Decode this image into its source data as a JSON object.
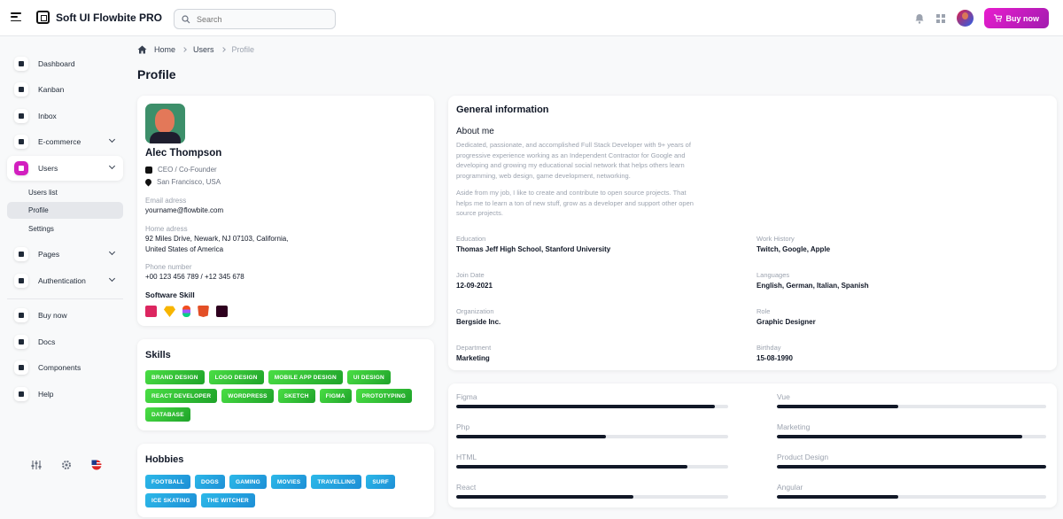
{
  "app": {
    "title": "Soft UI Flowbite PRO"
  },
  "search": {
    "placeholder": "Search"
  },
  "header": {
    "buy_label": "Buy now"
  },
  "sidebar": {
    "items": [
      {
        "label": "Dashboard",
        "icon": "dashboard-icon"
      },
      {
        "label": "Kanban",
        "icon": "kanban-icon"
      },
      {
        "label": "Inbox",
        "icon": "inbox-icon"
      },
      {
        "label": "E-commerce",
        "icon": "ecommerce-icon"
      },
      {
        "label": "Users",
        "icon": "users-icon"
      },
      {
        "label": "Pages",
        "icon": "pages-icon"
      },
      {
        "label": "Authentication",
        "icon": "authentication-icon"
      },
      {
        "label": "Buy now",
        "icon": "cart-icon"
      },
      {
        "label": "Docs",
        "icon": "docs-icon"
      },
      {
        "label": "Components",
        "icon": "components-icon"
      },
      {
        "label": "Help",
        "icon": "help-icon"
      }
    ],
    "users_sub": [
      "Users list",
      "Profile",
      "Settings"
    ]
  },
  "breadcrumb": {
    "home": "Home",
    "users": "Users",
    "current": "Profile"
  },
  "page": {
    "title": "Profile"
  },
  "profile": {
    "name": "Alec Thompson",
    "role": "CEO / Co-Founder",
    "location": "San Francisco, USA",
    "email_label": "Email adress",
    "email": "yourname@flowbite.com",
    "home_label": "Home adress",
    "home_line1": "92 Miles Drive, Newark, NJ 07103, California,",
    "home_line2": "United States of America",
    "phone_label": "Phone number",
    "phone": "+00 123 456 789 / +12 345 678",
    "software_title": "Software Skill"
  },
  "skills": {
    "title": "Skills",
    "tags": [
      "BRAND DESIGN",
      "LOGO DESIGN",
      "MOBILE APP DESIGN",
      "UI DESIGN",
      "REACT DEVELOPER",
      "WORDPRESS",
      "SKETCH",
      "FIGMA",
      "PROTOTYPING",
      "DATABASE"
    ]
  },
  "hobbies": {
    "title": "Hobbies",
    "tags": [
      "FOOTBALL",
      "DOGS",
      "GAMING",
      "MOVIES",
      "TRAVELLING",
      "SURF",
      "ICE SKATING",
      "THE WITCHER"
    ]
  },
  "general": {
    "title": "General information",
    "about_title": "About me",
    "about_p1_l1": "Dedicated, passionate, and accomplished Full Stack Developer with 9+ years of",
    "about_p1_l2": "progressive experience working as an Independent Contractor for Google and",
    "about_p1_l3": "developing and growing my educational social network that helps others learn",
    "about_p1_l4": "programming, web design, game development, networking.",
    "about_p2_l1": "Aside from my job, I like to create and contribute to open source projects. That",
    "about_p2_l2": "helps me to learn a ton of new stuff, grow as a developer and support other open",
    "about_p2_l3": "source projects.",
    "fields": [
      {
        "label": "Education",
        "value": "Thomas Jeff High School, Stanford University"
      },
      {
        "label": "Work History",
        "value": "Twitch, Google, Apple"
      },
      {
        "label": "Join Date",
        "value": "12-09-2021"
      },
      {
        "label": "Languages",
        "value": "English, German, Italian, Spanish"
      },
      {
        "label": "Organization",
        "value": "Bergside Inc."
      },
      {
        "label": "Role",
        "value": "Graphic Designer"
      },
      {
        "label": "Department",
        "value": "Marketing"
      },
      {
        "label": "Birthday",
        "value": "15-08-1990"
      }
    ]
  },
  "skill_bars": [
    {
      "label": "Figma",
      "level": 0.95
    },
    {
      "label": "Vue",
      "level": 0.45
    },
    {
      "label": "Php",
      "level": 0.55
    },
    {
      "label": "Marketing",
      "level": 0.91
    },
    {
      "label": "HTML",
      "level": 0.85
    },
    {
      "label": "Product Design",
      "level": 1.0
    },
    {
      "label": "React",
      "level": 0.65
    },
    {
      "label": "Angular",
      "level": 0.45
    }
  ],
  "colors": {
    "accent": "#d21fbf",
    "tag_green": "#3cc03a",
    "tag_blue": "#22a6e0"
  }
}
